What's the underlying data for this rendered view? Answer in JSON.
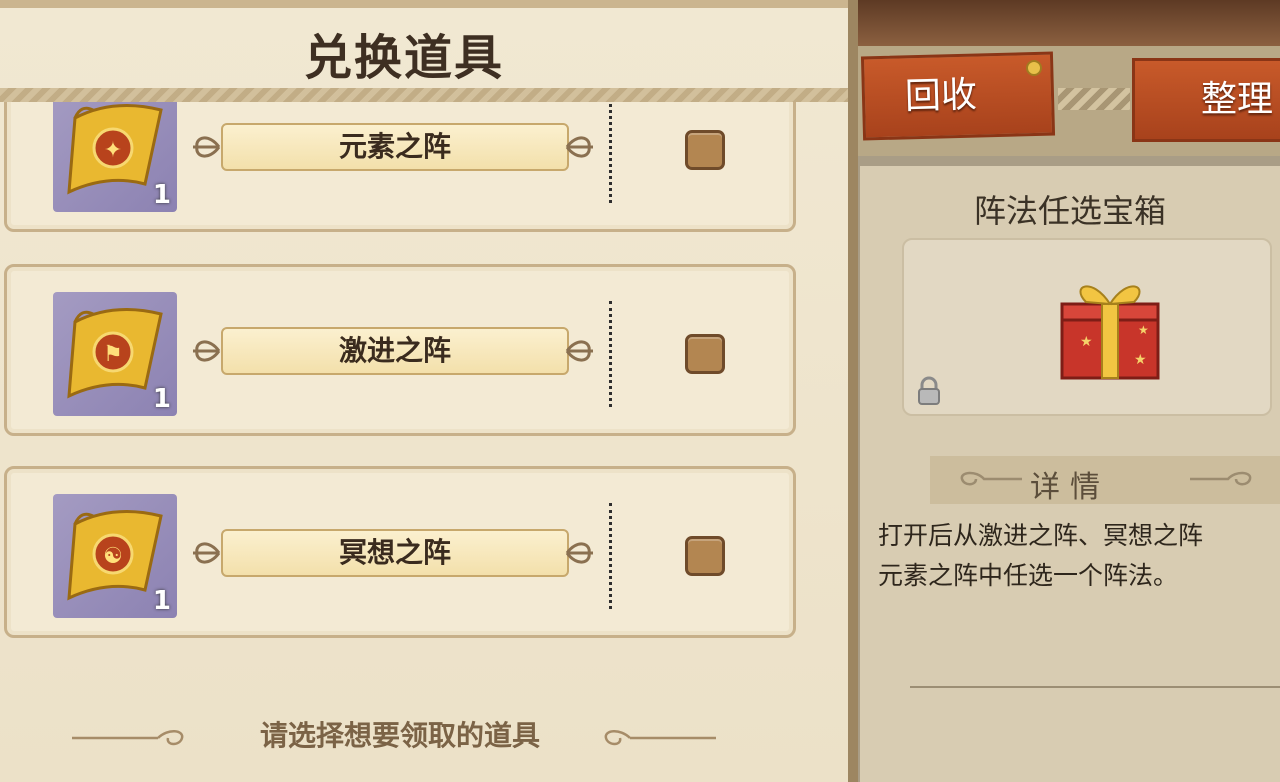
{
  "exchange_panel": {
    "title": "兑换道具",
    "items": [
      {
        "name": "元素之阵",
        "count": "1",
        "icon": "scroll-element-icon",
        "selected": false
      },
      {
        "name": "激进之阵",
        "count": "1",
        "icon": "scroll-aggressive-icon",
        "selected": false
      },
      {
        "name": "冥想之阵",
        "count": "1",
        "icon": "scroll-meditation-icon",
        "selected": false
      }
    ],
    "hint": "请选择想要领取的道具"
  },
  "inventory_panel": {
    "tabs": {
      "recycle": "回收",
      "sort": "整理"
    },
    "selected_item": {
      "title": "阵法任选宝箱",
      "icon": "gift-box-icon",
      "locked": true,
      "details_header": "详情",
      "description_lines": [
        "打开后从激进之阵、冥想之阵",
        "元素之阵中任选一个阵法。"
      ]
    }
  },
  "colors": {
    "accent_tab": "#b84c22",
    "checkbox": "#b38651",
    "icon_background": "#9a91bd",
    "parchment": "#f3ead4"
  }
}
